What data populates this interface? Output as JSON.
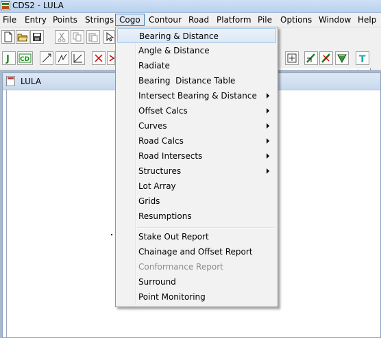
{
  "window": {
    "title": "CDS2 - LULA",
    "app_icon": "cds-app-icon"
  },
  "menubar": {
    "items": [
      {
        "label": "File"
      },
      {
        "label": "Entry"
      },
      {
        "label": "Points"
      },
      {
        "label": "Strings"
      },
      {
        "label": "Cogo",
        "active": true
      },
      {
        "label": "Contour"
      },
      {
        "label": "Road"
      },
      {
        "label": "Platform"
      },
      {
        "label": "Pile"
      },
      {
        "label": "Options"
      },
      {
        "label": "Window"
      },
      {
        "label": "Help"
      }
    ]
  },
  "toolbar": {
    "row1_icons": [
      "new-document-icon",
      "open-folder-icon",
      "save-icon",
      "cut-icon",
      "copy-icon",
      "paste-icon",
      "cursor-icon"
    ],
    "row2_icons": [
      "j-icon",
      "cd-icon",
      "line-icon",
      "polyline-icon",
      "angle-line-icon",
      "cross-point-icon",
      "arrow-icon",
      "grid-point-icon",
      "edit-string-icon",
      "delete-string-icon",
      "check-string-icon",
      "text-icon"
    ],
    "combo_value": ""
  },
  "child_window": {
    "title": "LULA"
  },
  "cogo_menu": {
    "items": [
      {
        "label": "Bearing & Distance",
        "highlight": true
      },
      {
        "label": "Angle & Distance"
      },
      {
        "label": "Radiate"
      },
      {
        "label": "Bearing  Distance Table"
      },
      {
        "label": "Intersect Bearing & Distance",
        "submenu": true
      },
      {
        "label": "Offset Calcs",
        "submenu": true
      },
      {
        "label": "Curves",
        "submenu": true
      },
      {
        "label": "Road Calcs",
        "submenu": true
      },
      {
        "label": "Road Intersects",
        "submenu": true
      },
      {
        "label": "Structures",
        "submenu": true
      },
      {
        "label": "Lot Array"
      },
      {
        "label": "Grids"
      },
      {
        "label": "Resumptions"
      },
      {
        "label": "Stake Out Report"
      },
      {
        "label": "Chainage and Offset Report"
      },
      {
        "label": "Conformance Report",
        "disabled": true
      },
      {
        "label": "Surround"
      },
      {
        "label": "Point Monitoring"
      }
    ]
  },
  "colors": {
    "menu_highlight_border": "#a8c9ea",
    "mdi_background": "#abb8c8",
    "disabled_text": "#8c8c8c"
  }
}
